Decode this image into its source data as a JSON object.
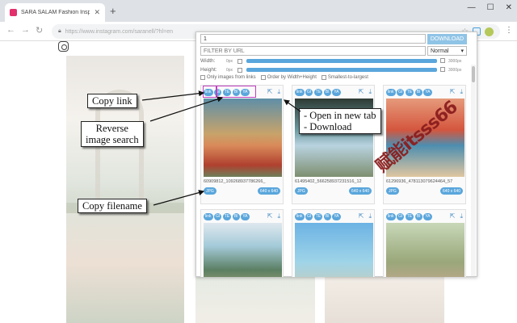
{
  "browser": {
    "tab_title": "SARA SALAM Fashion Inspiratio...",
    "url": "https://www.instagram.com/saranell/?hl=en"
  },
  "panel": {
    "query_value": "1",
    "download_label": "DOWNLOAD",
    "filter_placeholder": "FILTER BY URL",
    "mode_selected": "Normal",
    "width_label": "Width:",
    "height_label": "Height:",
    "min_px": "0px",
    "max_px": "3000px",
    "options": [
      "Only images from links",
      "Order by Width+Height",
      "Smallest-to-largest"
    ],
    "button_labels": [
      "link",
      "GI",
      "TE",
      "BI",
      "YA"
    ],
    "cards": [
      {
        "filename": "60909812_109268937786266_",
        "type": "JPG",
        "size": "640 x 640"
      },
      {
        "filename": "61495402_566258937231516_12",
        "type": "JPG",
        "size": "640 x 640"
      },
      {
        "filename": "61296936_478113079624464_57",
        "type": "JPG",
        "size": "640 x 640"
      },
      {
        "filename": "",
        "type": "",
        "size": ""
      },
      {
        "filename": "",
        "type": "",
        "size": ""
      },
      {
        "filename": "",
        "type": "",
        "size": ""
      }
    ]
  },
  "annotations": {
    "copy_link": "Copy link",
    "reverse_1": "Reverse",
    "reverse_2": "image search",
    "open_tab": "- Open in new tab",
    "download": "- Download",
    "copy_filename": "Copy filename"
  },
  "watermark": "赋能itsss66",
  "colors": {
    "accent": "#5aa6dc",
    "highlight": "#c040c0",
    "watermark": "#8b1e1e"
  }
}
